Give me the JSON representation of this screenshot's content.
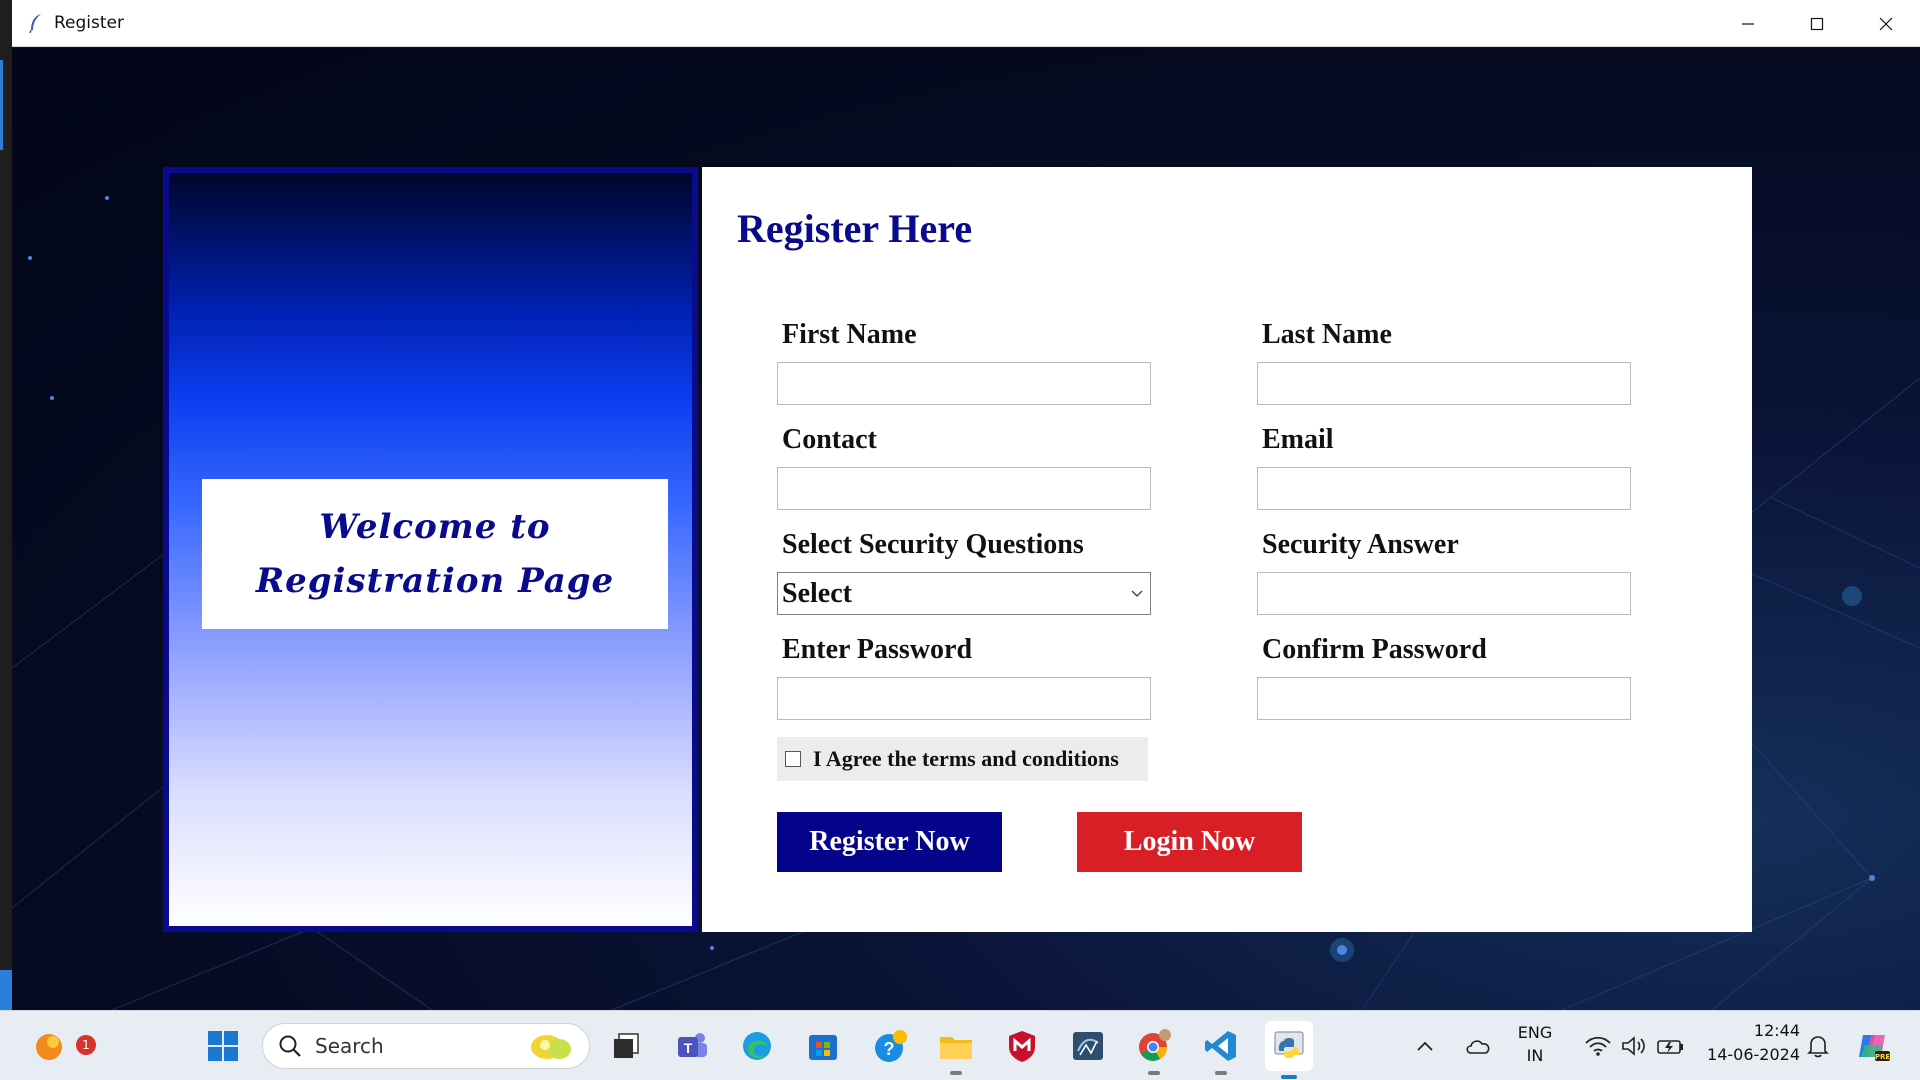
{
  "window": {
    "title": "Register",
    "controls": [
      "minimize-icon",
      "maximize-icon",
      "close-icon"
    ]
  },
  "welcome": {
    "line1": "Welcome to",
    "line2": "Registration Page"
  },
  "form": {
    "title": "Register Here",
    "first_name_label": "First Name",
    "first_name_value": "",
    "last_name_label": "Last Name",
    "last_name_value": "",
    "contact_label": "Contact",
    "contact_value": "",
    "email_label": "Email",
    "email_value": "",
    "security_question_label": "Select Security Questions",
    "security_question_selected": "Select",
    "security_answer_label": "Security Answer",
    "security_answer_value": "",
    "password_label": "Enter Password",
    "password_value": "",
    "confirm_password_label": "Confirm Password",
    "confirm_password_value": "",
    "terms_label": "I Agree the terms and conditions",
    "terms_checked": false,
    "register_button": "Register Now",
    "login_button": "Login Now",
    "colors": {
      "accent": "#04048a",
      "login": "#d91f26"
    }
  },
  "taskbar": {
    "notification_count": "1",
    "search_placeholder": "Search",
    "apps": [
      "widgets-icon",
      "windows-start-icon",
      "search-icon",
      "task-view-icon",
      "teams-icon",
      "edge-icon",
      "store-icon",
      "help-icon",
      "file-explorer-icon",
      "mcafee-icon",
      "mysql-icon",
      "chrome-icon",
      "vscode-icon",
      "python-icon"
    ],
    "language_line1": "ENG",
    "language_line2": "IN",
    "time": "12:44",
    "date": "14-06-2024"
  }
}
